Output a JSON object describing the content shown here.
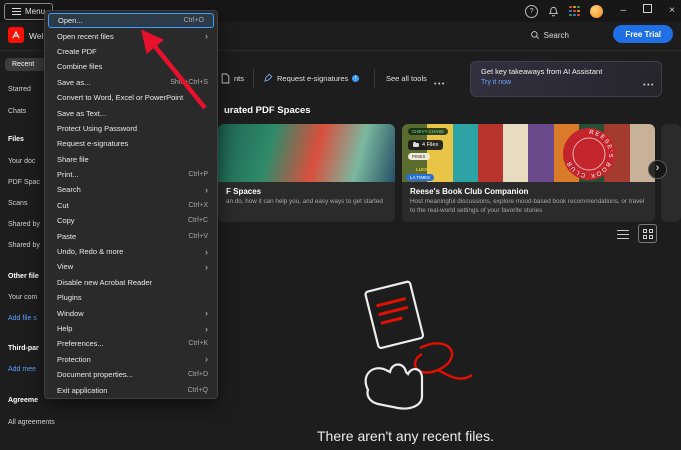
{
  "titlebar": {
    "menu_button_label": "Menu"
  },
  "header": {
    "welcome_fragment": "Wel",
    "search_label": "Search",
    "free_trial_label": "Free Trial"
  },
  "menu": {
    "items": [
      {
        "label": "Open...",
        "shortcut": "Ctrl+O"
      },
      {
        "label": "Open recent files"
      },
      {
        "label": "Create PDF"
      },
      {
        "label": "Combine files"
      },
      {
        "label": "Save as...",
        "shortcut": "Shift+Ctrl+S"
      },
      {
        "label": "Convert to Word, Excel or PowerPoint"
      },
      {
        "label": "Save as Text..."
      },
      {
        "label": "Protect Using Password"
      },
      {
        "label": "Request e-signatures"
      },
      {
        "label": "Share file"
      },
      {
        "label": "Print...",
        "shortcut": "Ctrl+P"
      },
      {
        "label": "Search"
      },
      {
        "label": "Cut",
        "shortcut": "Ctrl+X"
      },
      {
        "label": "Copy",
        "shortcut": "Ctrl+C"
      },
      {
        "label": "Paste",
        "shortcut": "Ctrl+V"
      },
      {
        "label": "Undo, Redo & more"
      },
      {
        "label": "View"
      },
      {
        "label": "Disable new Acrobat Reader"
      },
      {
        "label": "Plugins"
      },
      {
        "label": "Window"
      },
      {
        "label": "Help"
      },
      {
        "label": "Preferences...",
        "shortcut": "Ctrl+K"
      },
      {
        "label": "Protection"
      },
      {
        "label": "Document properties...",
        "shortcut": "Ctrl+D"
      },
      {
        "label": "Exit application",
        "shortcut": "Ctrl+Q"
      }
    ],
    "highlighted_item": "Open..."
  },
  "sidebar": {
    "tabs": [
      {
        "label": "Recent"
      },
      {
        "label": "Starred"
      },
      {
        "label": "Chats"
      }
    ],
    "sections": {
      "files": {
        "header": "Files",
        "items": [
          "Your doc",
          "PDF Spac",
          "Scans",
          "Shared by",
          "Shared by"
        ]
      },
      "other": {
        "header": "Other file",
        "items": [
          "Your com"
        ],
        "link": "Add file s"
      },
      "third_party": {
        "header": "Third-par",
        "link": "Add mee"
      },
      "agreements": {
        "header": "Agreeme",
        "items": [
          "All agreements"
        ]
      }
    }
  },
  "toolbar": {
    "documents_fragment": "nts",
    "esign_label": "Request e-signatures",
    "see_all_tools_label": "See all tools"
  },
  "ai_banner": {
    "title": "Get key takeaways from AI Assistant",
    "cta_label": "Try it now"
  },
  "spaces": {
    "heading_fragment": "urated PDF Spaces",
    "cards": [
      {
        "title_fragment": "F Spaces",
        "description_fragment": "an do, how it can help you, and easy ways to get started"
      },
      {
        "title": "Reese's Book Club Companion",
        "description": "Host meaningful discussions, explore mood-based book recommendations, or travel to the real-world settings of your favorite stories",
        "files_badge": "4 Files",
        "circle_text": "REESE'S BOOK CLUB",
        "image_labels": [
          "CHEVY CHASE",
          "PINES",
          "LUCKY",
          "LA TIMES"
        ]
      }
    ]
  },
  "recent_section": {
    "empty_message": "There aren't any recent files."
  },
  "colors": {
    "accent_blue": "#1f6fe5",
    "acrobat_red": "#fa0f00",
    "annotation_arrow_red": "#e8112d",
    "link_blue": "#5aa0ff",
    "highlight_border_blue": "#3f9bfd"
  }
}
